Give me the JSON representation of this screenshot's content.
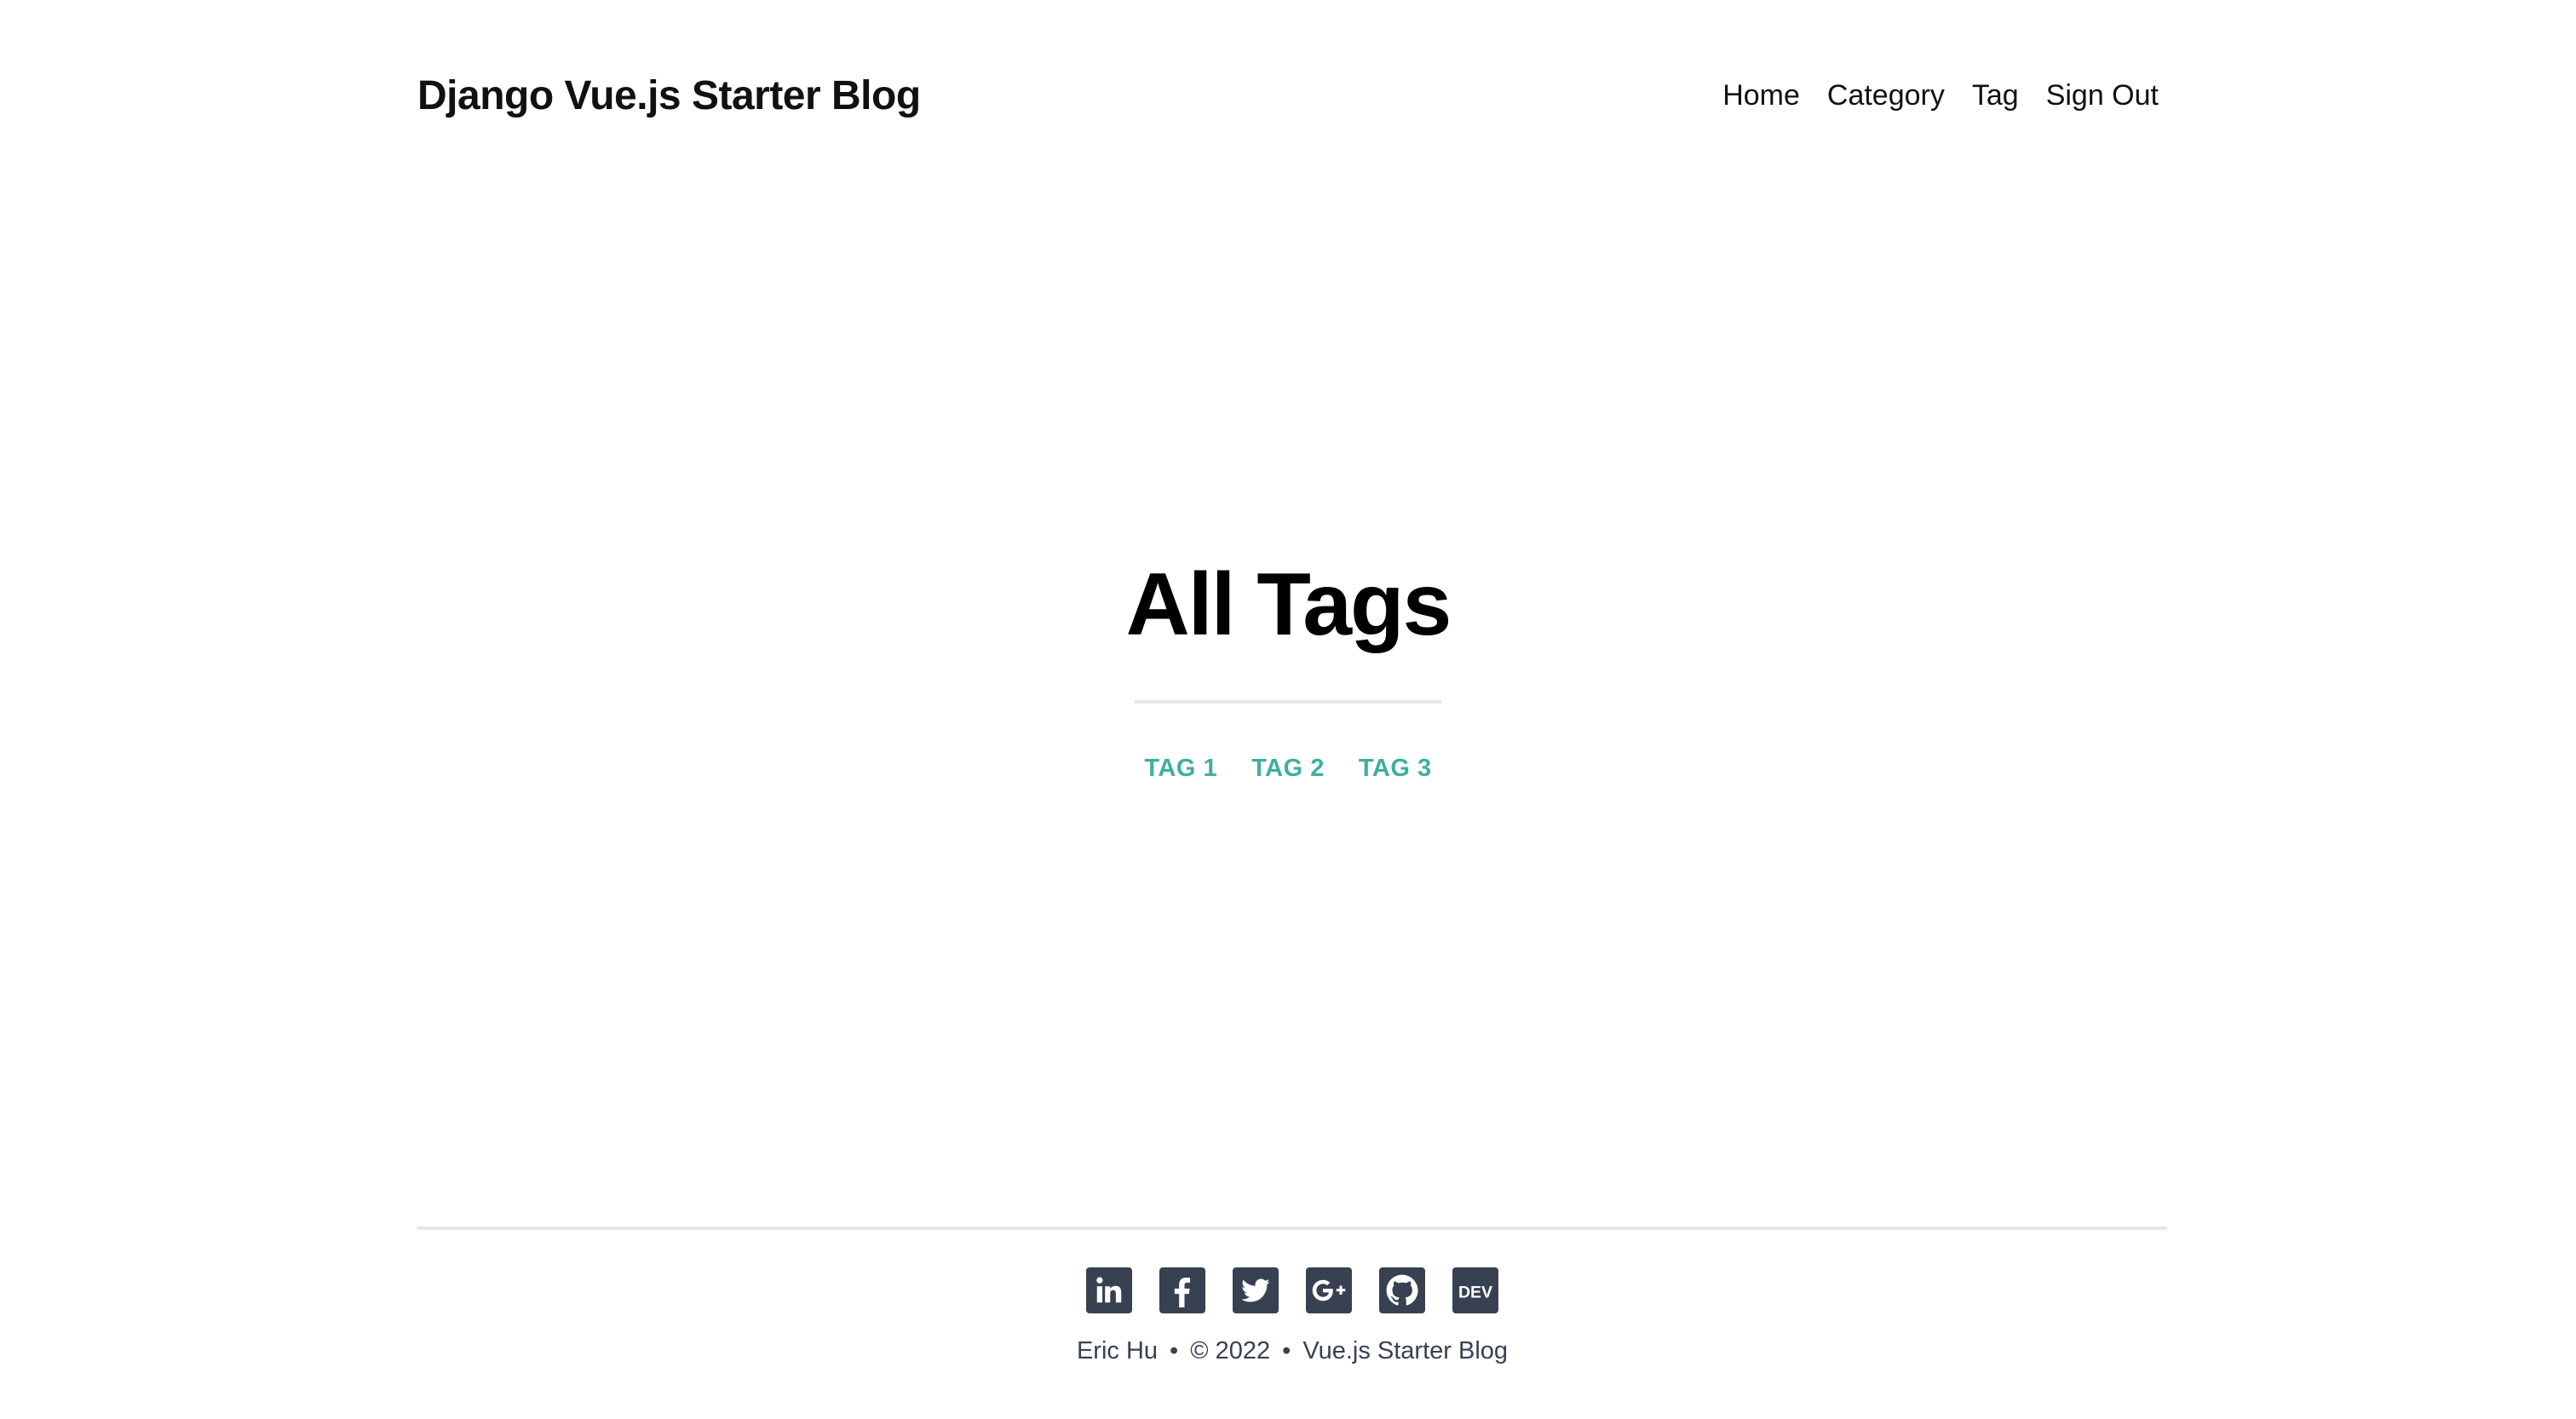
{
  "header": {
    "site_title": "Django Vue.js Starter Blog",
    "nav": [
      "Home",
      "Category",
      "Tag",
      "Sign Out"
    ]
  },
  "main": {
    "title": "All Tags",
    "tags": [
      "TAG 1",
      "TAG 2",
      "TAG 3"
    ]
  },
  "footer": {
    "socials": [
      "linkedin-icon",
      "facebook-icon",
      "twitter-icon",
      "google-plus-icon",
      "github-icon",
      "dev-icon"
    ],
    "author": "Eric Hu",
    "separator": "•",
    "copyright": "© 2022",
    "blog_name": "Vue.js Starter Blog"
  },
  "colors": {
    "accent": "#3eaf9f",
    "icon_bg": "#374151",
    "rule": "#e5e7eb"
  }
}
